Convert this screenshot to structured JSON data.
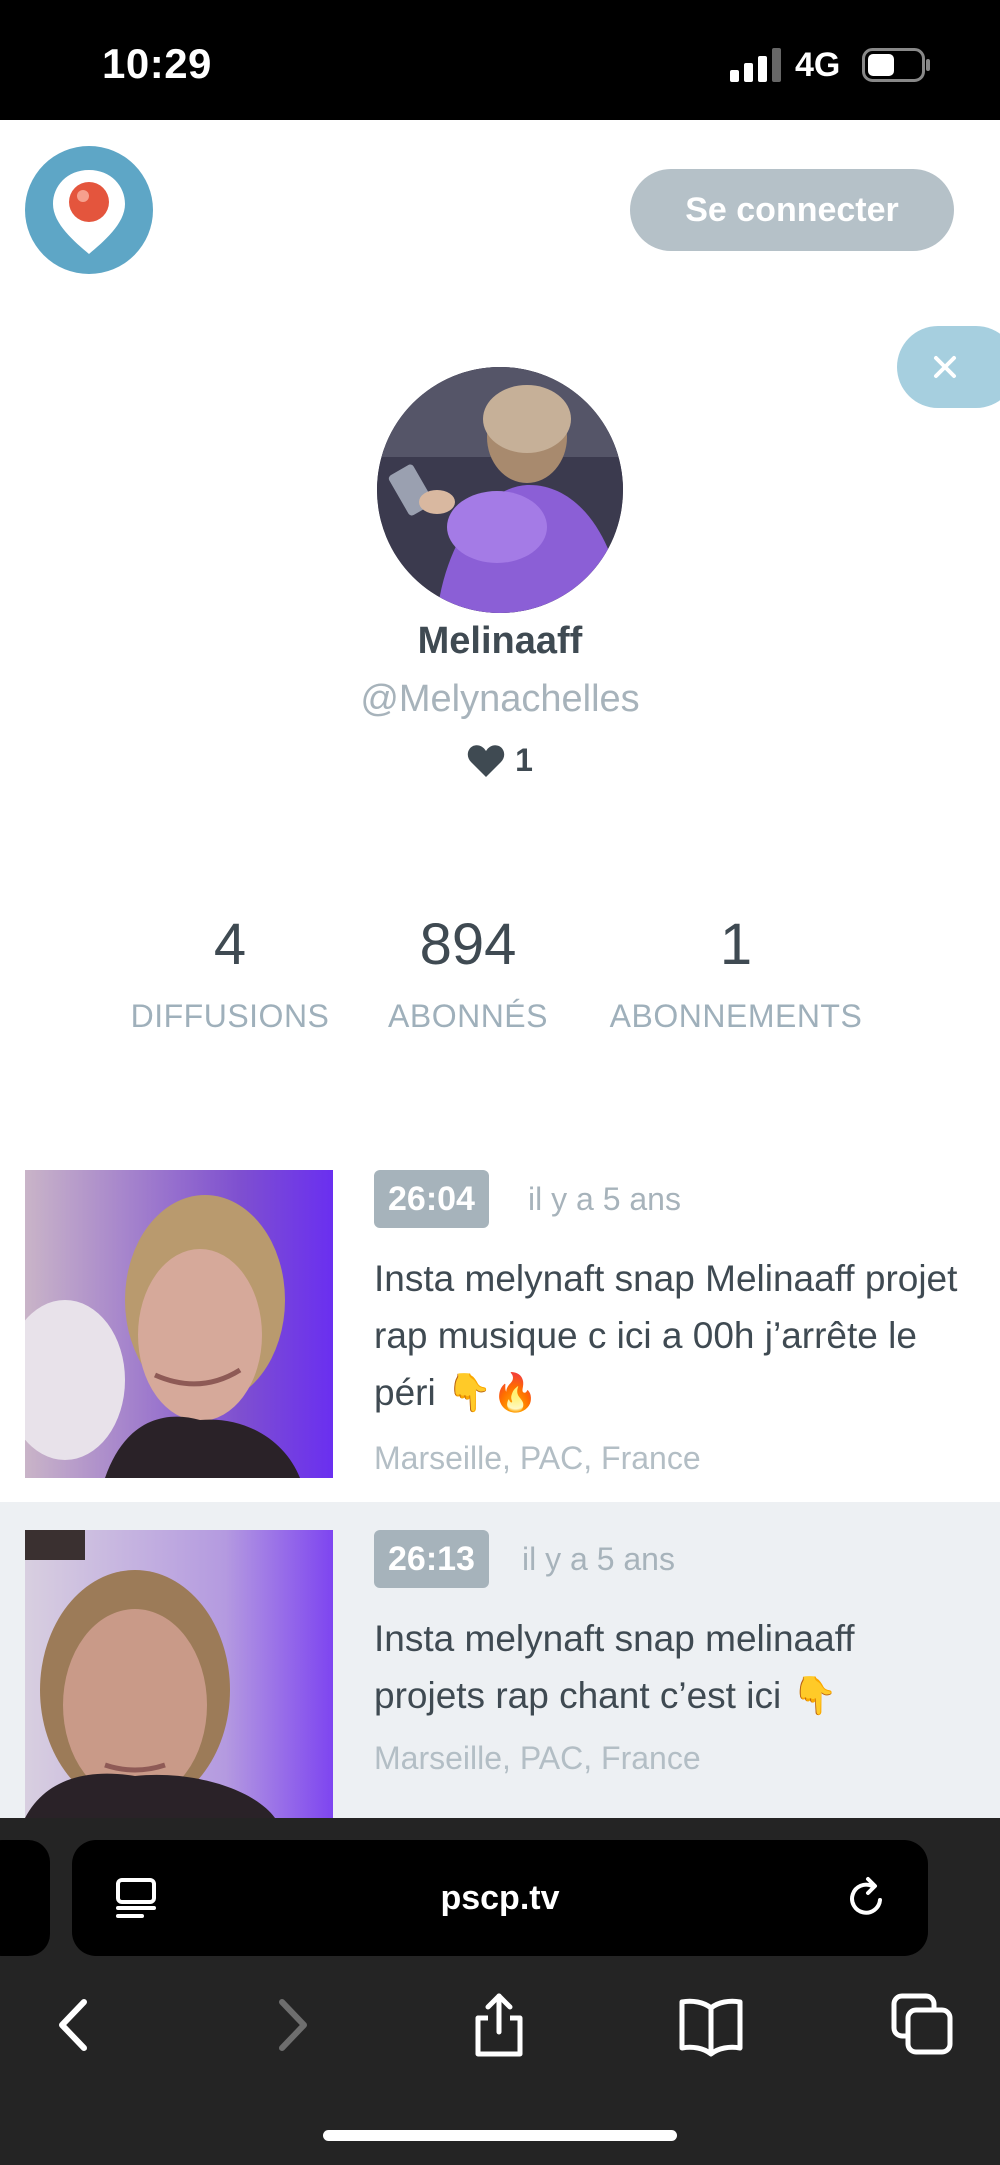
{
  "status_bar": {
    "time": "10:29",
    "network": "4G"
  },
  "header": {
    "connect_label": "Se connecter"
  },
  "profile": {
    "name": "Melinaaff",
    "handle": "@Melynachelles",
    "hearts": "1"
  },
  "stats": [
    {
      "value": "4",
      "label": "DIFFUSIONS"
    },
    {
      "value": "894",
      "label": "ABONNÉS"
    },
    {
      "value": "1",
      "label": "ABONNEMENTS"
    }
  ],
  "broadcasts": [
    {
      "duration": "26:04",
      "time_ago": "il y a 5 ans",
      "title": "Insta melynaft snap Melinaaff projet rap musique c ici a 00h j’arrête le péri 👇🔥",
      "location": "Marseille, PAC, France"
    },
    {
      "duration": "26:13",
      "time_ago": "il y a 5 ans",
      "title": "Insta melynaft snap melinaaff projets rap chant c’est ici 👇",
      "location": "Marseille, PAC, France"
    }
  ],
  "browser": {
    "url": "pscp.tv"
  },
  "colors": {
    "logo_blue": "#5ea6c6",
    "button_gray": "#b5c1c8",
    "text_dark": "#3f4a52",
    "text_muted": "#a7b3bb",
    "badge_gray": "#a6b3bb",
    "row_alt_bg": "#edf0f3"
  }
}
